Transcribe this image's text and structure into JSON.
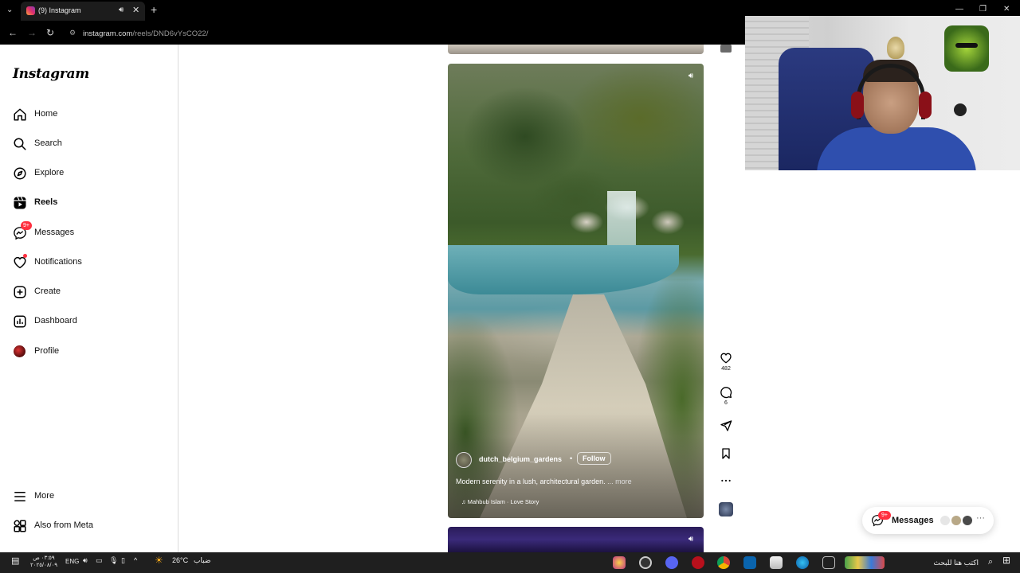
{
  "browser": {
    "tab_title": "(9) Instagram",
    "url_domain": "instagram.com",
    "url_path": "/reels/DND6vYsCO22/"
  },
  "sidebar": {
    "logo": "Instagram",
    "items": [
      {
        "label": "Home",
        "icon": "home-icon"
      },
      {
        "label": "Search",
        "icon": "search-icon"
      },
      {
        "label": "Explore",
        "icon": "compass-icon"
      },
      {
        "label": "Reels",
        "icon": "reels-icon",
        "active": true
      },
      {
        "label": "Messages",
        "icon": "messenger-icon",
        "badge": "9+"
      },
      {
        "label": "Notifications",
        "icon": "heart-icon"
      },
      {
        "label": "Create",
        "icon": "plus-square-icon"
      },
      {
        "label": "Dashboard",
        "icon": "bar-chart-icon"
      },
      {
        "label": "Profile",
        "icon": "avatar"
      }
    ],
    "more": "More",
    "also_from_meta": "Also from Meta"
  },
  "reel": {
    "author": "dutch_belgium_gardens",
    "separator": "•",
    "follow": "Follow",
    "caption": "Modern serenity in a lush, architectural garden.",
    "caption_more": "... more",
    "audio": "Mahbub Islam · Love Story"
  },
  "actions": {
    "likes": "482",
    "comments": "6"
  },
  "floating_messages": {
    "label": "Messages",
    "badge": "9+"
  },
  "taskbar": {
    "language": "ENG",
    "weather_temp": "26°C",
    "weather_desc": "ضباب",
    "time": "٠٣:٥٩ ص",
    "date": "٢٠٢٥/٠٨/٠٩",
    "search_placeholder": "اكتب هنا للبحث"
  },
  "colors": {
    "badge": "#ff3040",
    "text": "#000000",
    "border": "#dbdbdb",
    "chrome": "#000000",
    "taskbar": "#1f1f1f"
  }
}
